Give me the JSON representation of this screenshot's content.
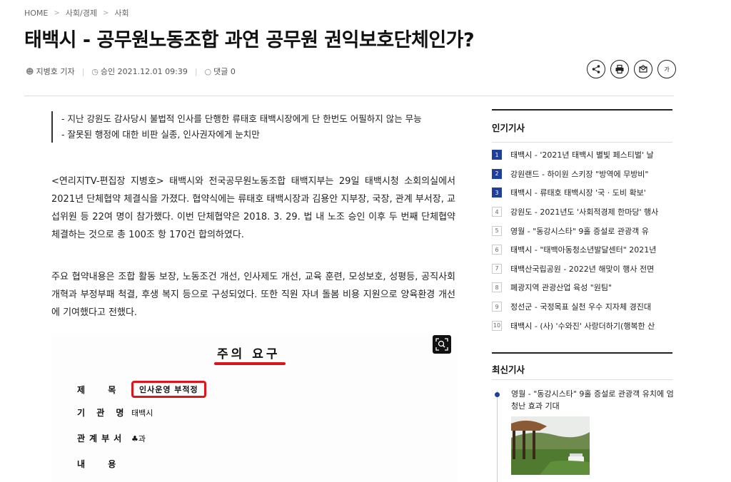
{
  "breadcrumb": [
    "HOME",
    "사회/경제",
    "사회"
  ],
  "article": {
    "title": "태백시 - 공무원노동조합 과연 공무원 권익보호단체인가?",
    "author": "지병호 기자",
    "approved": "승인 2021.12.01 09:39",
    "comments": "댓글 0",
    "more_label": "가",
    "summary": [
      "- 지난 강원도 감사당시 불법적 인사를 단행한 류태호 태백시장에게 단 한번도 어필하지 않는 무능",
      "- 잘못된 행정에 대한 비판 실종, 인사권자에게 눈치만"
    ],
    "paragraphs": [
      "<연리지TV-편집장 지병호> 태백시와 전국공무원노동조합 태백지부는 29일 태백시청 소회의실에서 2021년 단체협약 체결식을 가졌다. 협약식에는 류태호 태백시장과 김용안 지부장, 국장, 관계 부서장, 교섭위원 등 22여 명이 참가했다. 이번 단체협약은 2018. 3. 29. 법 내 노조 승인 이후 두 번째 단체협약 체결하는 것으로 총 100조 항 170건 합의하였다.",
      "주요 협약내용은 조합 활동 보장, 노동조건 개선, 인사제도 개선, 교육 훈련, 모성보호, 성평등, 공직사회 개혁과 부정부패 척결, 후생 복지 등으로 구성되었다. 또한 직원 자녀 돌봄 비용 지원으로 양육환경 개선에 기여했다고 전했다."
    ],
    "document": {
      "heading": "주의 요구",
      "rows": [
        {
          "label": "제 목",
          "value": "인사운영 부적정"
        },
        {
          "label": "기 관 명",
          "value": "태백시"
        },
        {
          "label": "관계부서",
          "value": "♣과"
        },
        {
          "label": "내 용",
          "value": ""
        }
      ]
    }
  },
  "popular": {
    "heading": "인기기사",
    "items": [
      "태백시 - '2021년 태백시 별빛 페스티벌' 날",
      "강원랜드 - 하이원 스키장 \"방역에 무방비\"",
      "태백시 - 류태호 태백시장 '국 · 도비 확보'",
      "강원도 - 2021년도 '사회적경제 한마당' 행사",
      "영월 - \"동강시스타\" 9홀 증설로 관광객 유",
      "태백시 - \"태백아동청소년발달센터\" 2021년",
      "태백산국립공원 - 2022년 해맞이 행사 전면",
      "폐광지역 관광산업 육성 \"원팀\"",
      "정선군 - 국정목표 실천 우수 지자체 경진대",
      "태백시 - (사) '수와진' 사랑더하기(행복한 산"
    ]
  },
  "latest": {
    "heading": "최신기사",
    "item": "영월 - \"동강시스타\" 9홀 증설로 관광객 유치에 엄청난 효과 기대"
  },
  "colors": {
    "accent": "#1f3f9a",
    "highlight": "#e0151c"
  }
}
